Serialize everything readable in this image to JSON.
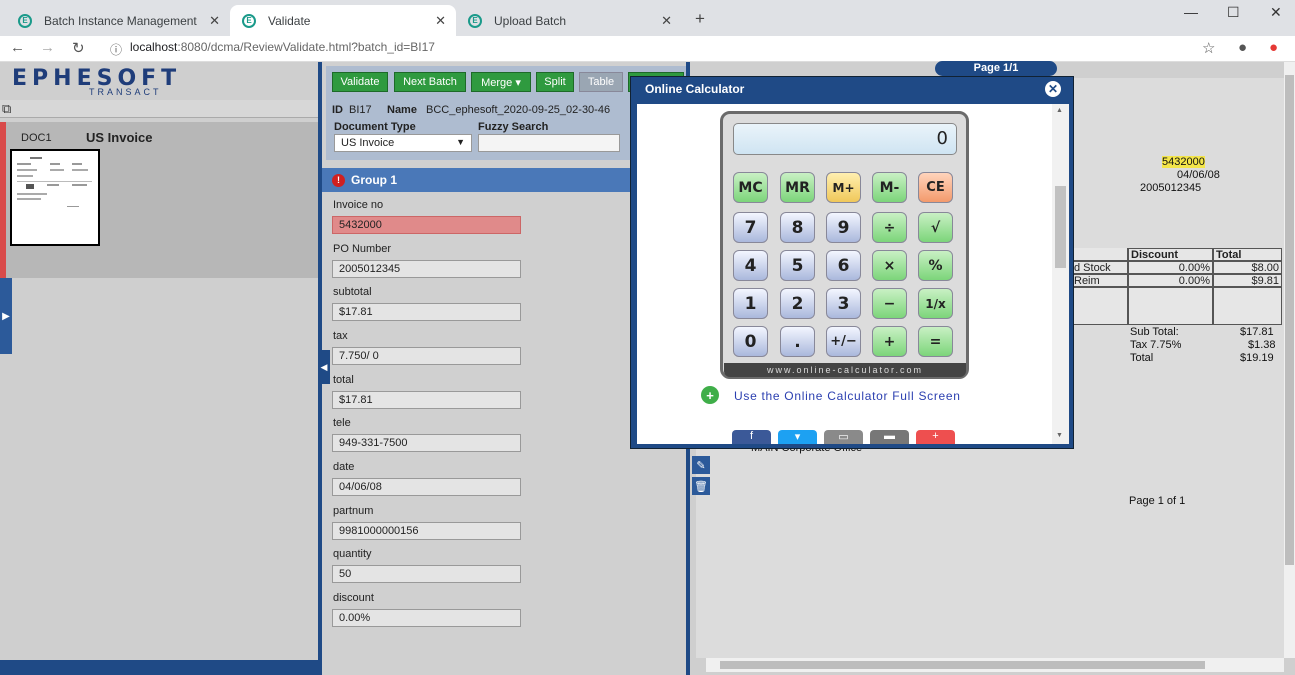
{
  "browser": {
    "tabs": [
      {
        "label": "Batch Instance Management",
        "active": false
      },
      {
        "label": "Validate",
        "active": true
      },
      {
        "label": "Upload Batch",
        "active": false
      }
    ],
    "url_host": "localhost",
    "url_rest": ":8080/dcma/ReviewValidate.html?batch_id=BI17"
  },
  "logo": {
    "main": "EPHESOFT",
    "sub": "TRANSACT"
  },
  "document_list": {
    "doc_id": "DOC1",
    "doc_title": "US Invoice"
  },
  "toolbar": {
    "buttons": [
      "Validate",
      "Next Batch",
      "Merge ▾",
      "Split",
      "Table"
    ],
    "id_label": "ID",
    "id_value": "BI17",
    "name_label": "Name",
    "name_value": "BCC_ephesoft_2020-09-25_02-30-46",
    "document_type_label": "Document Type",
    "document_type_value": "US Invoice",
    "fuzzy_search_label": "Fuzzy Search"
  },
  "group": {
    "label": "Group 1"
  },
  "fields": [
    {
      "label": "Invoice no",
      "value": "5432000",
      "error": true
    },
    {
      "label": "PO Number",
      "value": "2005012345",
      "error": false
    },
    {
      "label": "subtotal",
      "value": "$17.81",
      "error": false
    },
    {
      "label": "tax",
      "value": "7.750/ 0",
      "error": false
    },
    {
      "label": "total",
      "value": "$17.81",
      "error": false
    },
    {
      "label": "tele",
      "value": "949-331-7500",
      "error": false
    },
    {
      "label": "date",
      "value": "04/06/08",
      "error": false
    },
    {
      "label": "partnum",
      "value": "9981000000156",
      "error": false
    },
    {
      "label": "quantity",
      "value": "50",
      "error": false
    },
    {
      "label": "discount",
      "value": "0.00%",
      "error": false
    }
  ],
  "document_view": {
    "page_header": "Page 1/1",
    "invoice_no": "5432000",
    "date": "04/06/08",
    "po_number": "2005012345",
    "table_headers": [
      "Discount",
      "Total"
    ],
    "table_rows": [
      {
        "desc": "d Stock",
        "discount": "0.00%",
        "total": "$8.00"
      },
      {
        "desc": "Reim",
        "discount": "0.00%",
        "total": "$9.81"
      }
    ],
    "sub_total_label": "Sub Total:",
    "sub_total": "$17.81",
    "tax_label": "Tax 7.75%",
    "tax": "$1.38",
    "total_label": "Total",
    "total": "$19.19",
    "office": "MAIN Corporate Office",
    "page_footer": "Page 1 of 1"
  },
  "calculator_popup": {
    "title": "Online Calculator",
    "display": "0",
    "keys": [
      [
        "MC",
        "MR",
        "M+",
        "M-",
        "CE"
      ],
      [
        "7",
        "8",
        "9",
        "÷",
        "√"
      ],
      [
        "4",
        "5",
        "6",
        "×",
        "%"
      ],
      [
        "1",
        "2",
        "3",
        "−",
        "1/x"
      ],
      [
        "0",
        ".",
        "+/−",
        "+",
        "="
      ]
    ],
    "footer_text": "www.online-calculator.com",
    "link_text": "Use the Online Calculator Full Screen"
  },
  "colors": {
    "brand_blue": "#1f4a86",
    "button_green": "#2f9a3f",
    "error_red": "#e08a8a",
    "highlight_yellow": "#f3e54a"
  }
}
